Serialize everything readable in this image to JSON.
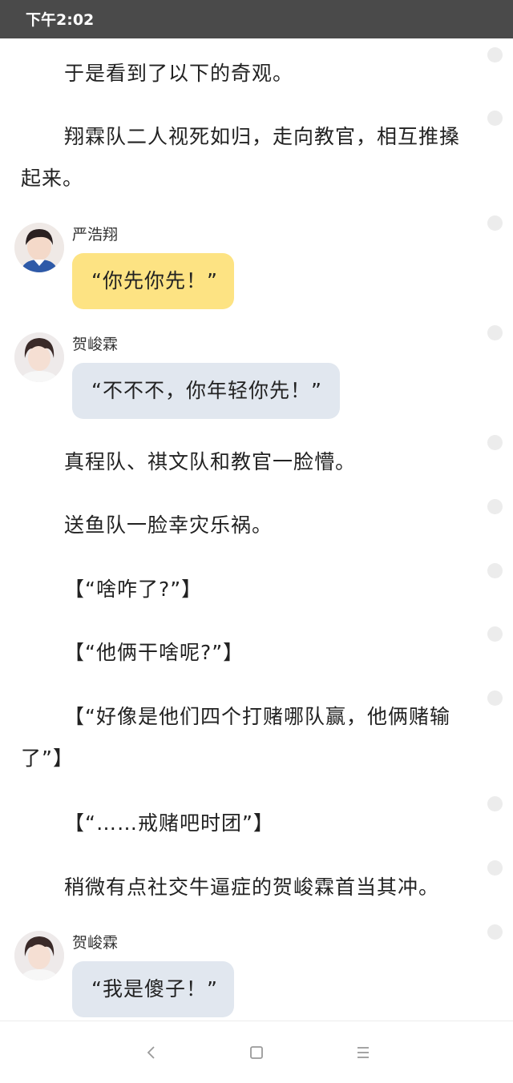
{
  "status_bar": {
    "time": "下午2:02"
  },
  "story": {
    "p1": "于是看到了以下的奇观。",
    "p2": "翔霖队二人视死如归，走向教官，相互推搡起来。",
    "chat1": {
      "speaker": "严浩翔",
      "text": "“你先你先！”",
      "avatar": "avatar-yan-haoxiang"
    },
    "chat2": {
      "speaker": "贺峻霖",
      "text": "“不不不，你年轻你先！”",
      "avatar": "avatar-he-junlin"
    },
    "p3": "真程队、祺文队和教官一脸懵。",
    "p4": "送鱼队一脸幸灾乐祸。",
    "p5": "【“啥咋了?”】",
    "p6": "【“他俩干啥呢?”】",
    "p7": "【“好像是他们四个打赌哪队赢，他俩赌输了”】",
    "p8": "【“……戒赌吧时团”】",
    "p9": "稍微有点社交牛逼症的贺峻霖首当其冲。",
    "chat3": {
      "speaker": "贺峻霖",
      "text": "“我是傻子！”",
      "avatar": "avatar-he-junlin"
    }
  },
  "nav_bar": {
    "back": "back-icon",
    "home": "home-icon",
    "menu": "menu-icon"
  },
  "colors": {
    "status_bar": "#4a4a4a",
    "bubble_yellow": "#fde383",
    "bubble_blue": "#e1e7ef",
    "dot": "#ececec"
  }
}
